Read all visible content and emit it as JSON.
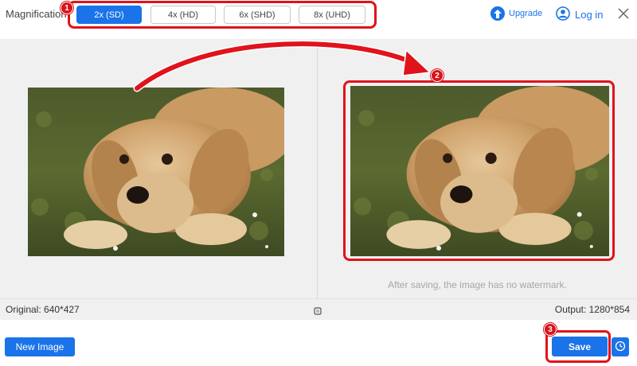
{
  "header": {
    "magnification_label": "Magnification",
    "options": [
      {
        "label": "2x (SD)",
        "active": true
      },
      {
        "label": "4x (HD)",
        "active": false
      },
      {
        "label": "6x (SHD)",
        "active": false
      },
      {
        "label": "8x (UHD)",
        "active": false
      }
    ],
    "upgrade_label": "Upgrade",
    "upgrade_icon": "upgrade-arrow-icon",
    "login_label": "Log in",
    "login_icon": "user-icon",
    "close_icon": "close-icon"
  },
  "annotations": {
    "step1": "1",
    "step2": "2",
    "step3": "3",
    "highlight_color": "#e0131b"
  },
  "preview": {
    "original_image_alt": "puppy",
    "output_image_alt": "puppy",
    "watermark_note": "After saving, the image has no watermark."
  },
  "info": {
    "original_size": "Original: 640*427",
    "output_size": "Output: 1280*854",
    "compare_icon": "compare-square-icon"
  },
  "footer": {
    "new_image_label": "New Image",
    "save_label": "Save",
    "history_icon": "clock-icon"
  },
  "colors": {
    "accent": "#1a73e8",
    "background": "#f0f0f1",
    "highlight": "#e0131b"
  }
}
